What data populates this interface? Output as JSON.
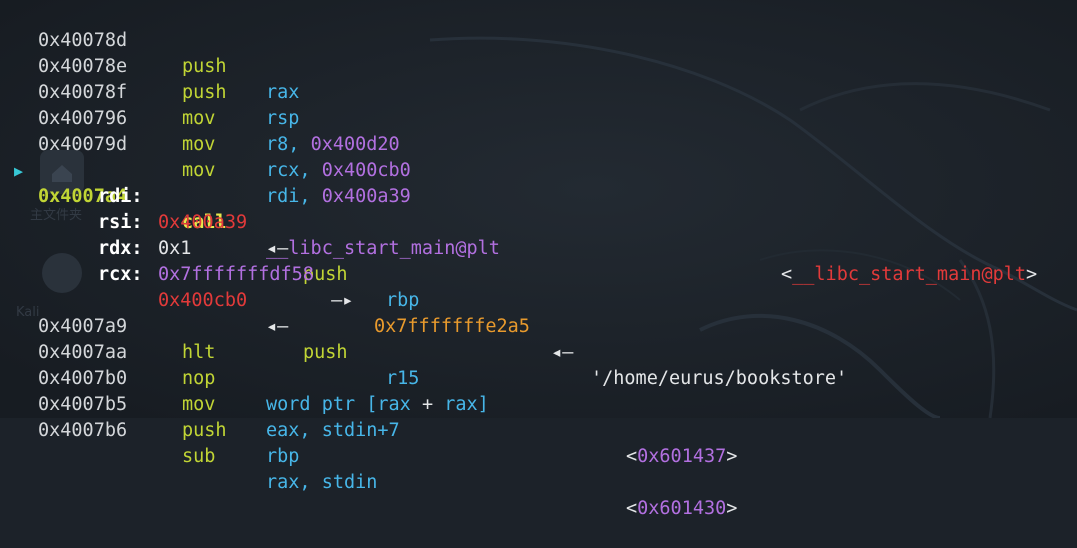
{
  "desktop": {
    "icon_labels": [
      "主文件夹",
      "Kali"
    ]
  },
  "disasm_top": [
    {
      "addr": "0x40078d",
      "mnemonic": "push",
      "operand": "rax"
    },
    {
      "addr": "0x40078e",
      "mnemonic": "push",
      "operand": "rsp"
    },
    {
      "addr": "0x40078f",
      "mnemonic": "mov",
      "operand_reg": "r8, ",
      "operand_num": "0x400d20"
    },
    {
      "addr": "0x400796",
      "mnemonic": "mov",
      "operand_reg": "rcx, ",
      "operand_num": "0x400cb0"
    },
    {
      "addr": "0x40079d",
      "mnemonic": "mov",
      "operand_reg": "rdi, ",
      "operand_num": "0x400a39"
    }
  ],
  "current": {
    "marker": "▶",
    "addr": "0x4007a4",
    "mnemonic": "call",
    "operand": "__libc_start_main@plt",
    "comment_open": "<",
    "comment_sym": "__libc_start_main@plt",
    "comment_close": ">"
  },
  "args": [
    {
      "reg": "rdi:",
      "value": "0x400a39",
      "arrow": "◂— ",
      "mnemonic": "push",
      "operand": "rbp"
    },
    {
      "reg": "rsi:",
      "value": "0x1"
    },
    {
      "reg": "rdx:",
      "value": "0x7fffffffdf58",
      "arrow": " —▸ ",
      "value2": "0x7fffffffe2a5",
      "arrow2": " ◂— ",
      "string": "'/home/eurus/bookstore'"
    },
    {
      "reg": "rcx:",
      "value": "0x400cb0",
      "arrow": "◂— ",
      "mnemonic": "push",
      "operand": "r15"
    }
  ],
  "disasm_bottom": [
    {
      "addr": "0x4007a9",
      "mnemonic": "hlt",
      "operand": ""
    },
    {
      "addr": "0x4007aa",
      "mnemonic": "nop",
      "operand_a": "word ptr [",
      "operand_b": "rax",
      "operand_c": " + ",
      "operand_d": "rax",
      "operand_e": "]"
    },
    {
      "addr": "0x4007b0",
      "mnemonic": "mov",
      "operand": "eax, stdin+7",
      "comment_open": "<",
      "comment_num": "0x601437",
      "comment_close": ">"
    },
    {
      "addr": "0x4007b5",
      "mnemonic": "push",
      "operand": "rbp"
    },
    {
      "addr": "0x4007b6",
      "mnemonic": "sub",
      "operand": "rax, stdin",
      "comment_open": "<",
      "comment_num": "0x601430",
      "comment_close": ">"
    }
  ]
}
